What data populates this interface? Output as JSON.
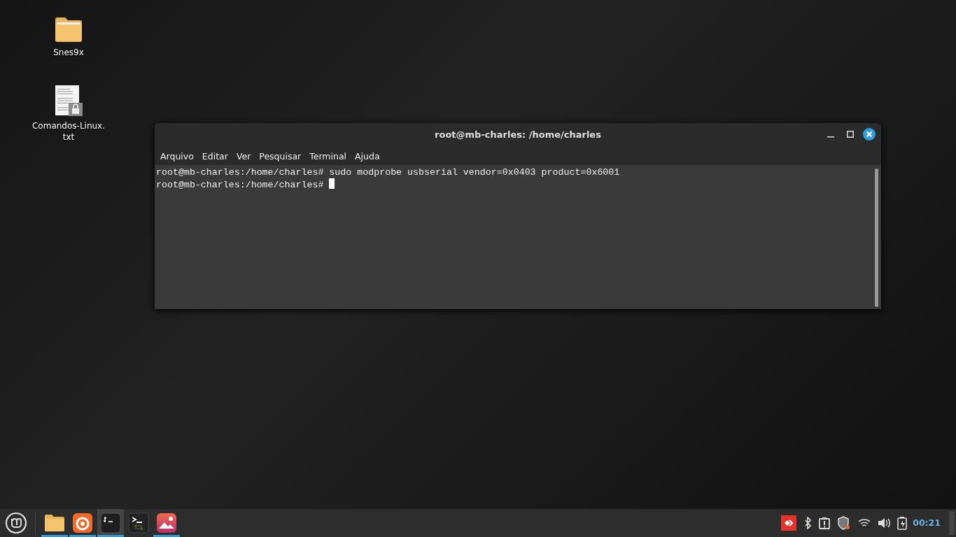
{
  "desktop_icons": [
    {
      "kind": "folder",
      "label": "Snes9x"
    },
    {
      "kind": "text-file",
      "label": "Comandos-Linux.\ntxt"
    }
  ],
  "window": {
    "title": "root@mb-charles: /home/charles",
    "menu": [
      "Arquivo",
      "Editar",
      "Ver",
      "Pesquisar",
      "Terminal",
      "Ajuda"
    ],
    "lines": [
      "root@mb-charles:/home/charles# sudo modprobe usbserial vendor=0x0403 product=0x6001",
      "root@mb-charles:/home/charles# "
    ]
  },
  "taskbar": {
    "apps": [
      {
        "kind": "files",
        "running": true,
        "selected": false
      },
      {
        "kind": "browser",
        "running": true,
        "selected": false
      },
      {
        "kind": "terminal",
        "running": true,
        "selected": true
      },
      {
        "kind": "console",
        "running": false,
        "selected": false
      },
      {
        "kind": "image-viewer",
        "running": true,
        "selected": false
      }
    ],
    "clock": "00:21"
  }
}
